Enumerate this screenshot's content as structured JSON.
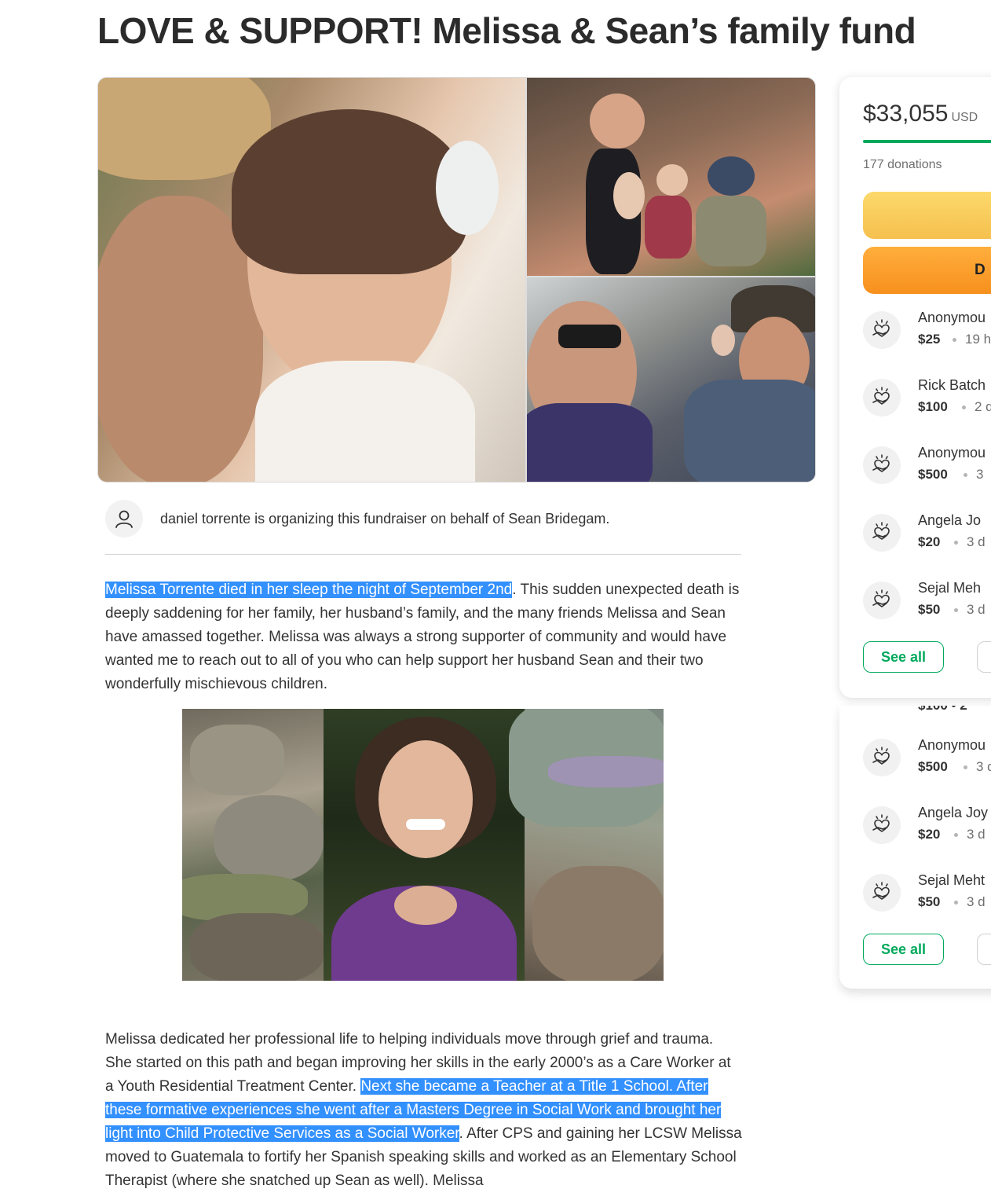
{
  "campaign": {
    "title": "LOVE & SUPPORT! Melissa & Sean’s family fund",
    "organizer_text": "daniel torrente is organizing this fundraiser on behalf of Sean Bridegam."
  },
  "story": {
    "p1_highlight": "Melissa Torrente died in her sleep the night of September 2nd",
    "p1_rest": ". This sudden unexpected death is deeply saddening for her family, her husband’s family, and the many friends Melissa and Sean have amassed together. Melissa was always a strong supporter of community and would have wanted me to reach out to all of you who can help support her husband Sean and their two wonderfully mischievous children.",
    "p2_start": "Melissa dedicated her professional life to helping individuals move through grief and trauma. She started on this path and began improving her skills in the early 2000’s as a Care Worker at a Youth Residential Treatment Center. ",
    "p2_highlight": "Next she became a Teacher at a Title 1 School. After these formative experiences she went after a Masters Degree in Social Work and brought her light into Child Protective Services as a Social Worker",
    "p2_rest": ". After CPS and gaining her LCSW Melissa moved to Guatemala to fortify her Spanish speaking skills and worked as an Elementary School Therapist (where she snatched up Sean as well). Melissa"
  },
  "sidebar": {
    "amount": "$33,055",
    "currency": "USD",
    "donations_count": "177 donations",
    "progress_fraction": 1.0,
    "donate_label": "D",
    "see_all_label": "See all",
    "donors": [
      {
        "name": "Anonymou",
        "amount": "$25",
        "time": "19 h"
      },
      {
        "name": "Rick Batch",
        "amount": "$100",
        "time": "2 d"
      },
      {
        "name": "Anonymou",
        "amount": "$500",
        "time": "3"
      },
      {
        "name": "Angela Jo",
        "amount": "$20",
        "time": "3 d"
      },
      {
        "name": "Sejal Meh",
        "amount": "$50",
        "time": "3 d"
      }
    ],
    "donors_lower": [
      {
        "name": "Anonymou",
        "amount": "$500",
        "time": "3 d"
      },
      {
        "name": "Angela Joy",
        "amount": "$20",
        "time": "3 d"
      },
      {
        "name": "Sejal Meht",
        "amount": "$50",
        "time": "3 d"
      }
    ],
    "partial_row": "$100  •  2"
  },
  "colors": {
    "accent_green": "#02a95c",
    "highlight_blue": "#3390ff",
    "donate_orange": "#f7901d",
    "share_yellow": "#f5c04e"
  },
  "icons": {
    "organizer_avatar": "user-icon",
    "donor_avatar": "heart-hand-icon"
  }
}
